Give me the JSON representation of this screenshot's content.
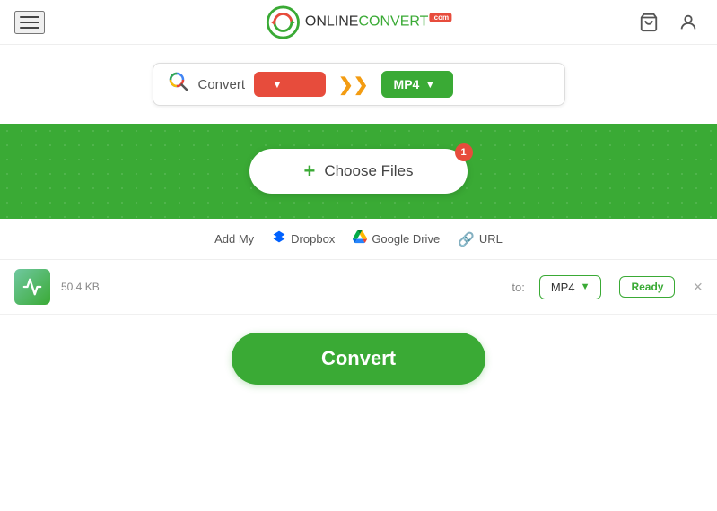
{
  "header": {
    "logo_online": "ONLINE",
    "logo_convert": "CONVERT",
    "logo_com": ".com",
    "menu_icon": "menu-icon",
    "cart_icon": "cart-icon",
    "user_icon": "user-icon"
  },
  "search": {
    "label": "Convert",
    "from_placeholder": "",
    "arrow_char": "⟫",
    "to_format": "MP4"
  },
  "dropzone": {
    "choose_files_label": "Choose Files",
    "badge_count": "1",
    "add_my_label": "Add My",
    "dropbox_label": "Dropbox",
    "gdrive_label": "Google Drive",
    "url_label": "URL"
  },
  "file": {
    "size": "50.4 KB",
    "to_label": "to:",
    "format": "MP4",
    "status": "Ready",
    "remove_label": "×"
  },
  "convert_button": {
    "label": "Convert"
  }
}
